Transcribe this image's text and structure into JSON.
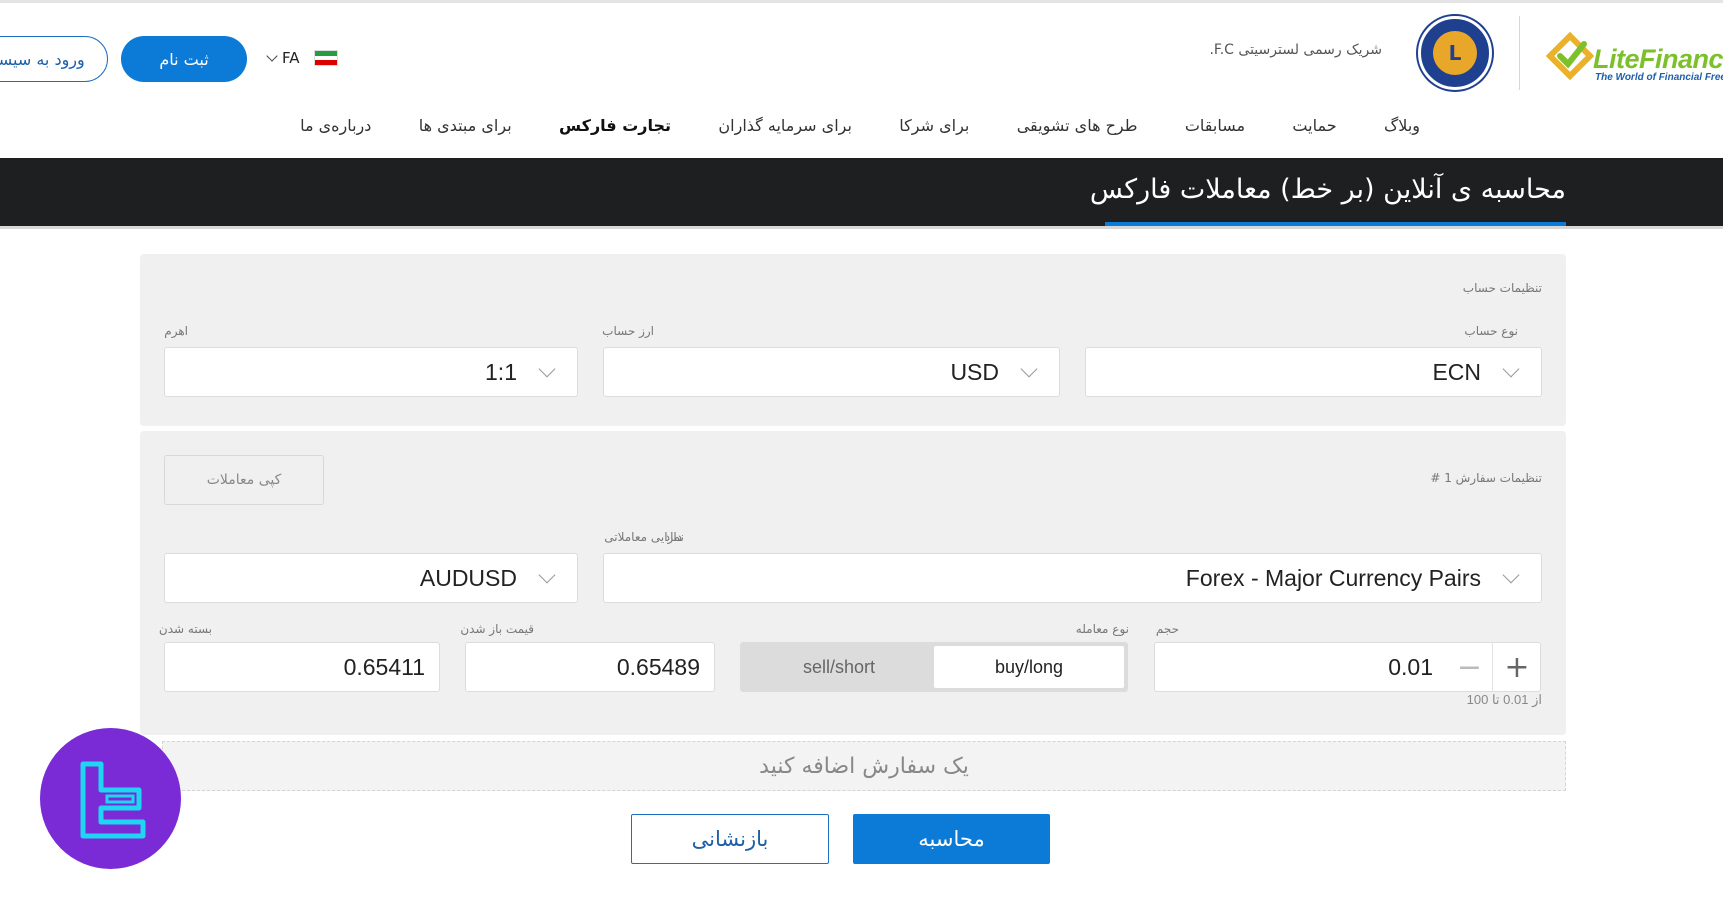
{
  "header": {
    "login_label": "ورود به سیستم",
    "signup_label": "ثبت نام",
    "language": "FA",
    "partner_text": "شریک رسمی لسترسیتی F.C.",
    "crest_letter": "L",
    "brand_name": "LiteFinance",
    "brand_tagline": "The World of Financial Freedom",
    "accent_color": "#0c7ad7",
    "brand_green": "#7cc12b"
  },
  "nav": {
    "items": [
      {
        "label": "درباره‌ی ما"
      },
      {
        "label": "برای مبتدی ها"
      },
      {
        "label": "تجارت فارکس"
      },
      {
        "label": "برای سرمایه گذاران"
      },
      {
        "label": "برای شرکا"
      },
      {
        "label": "طرح های تشویقی"
      },
      {
        "label": "مسابقات"
      },
      {
        "label": "حمایت"
      },
      {
        "label": "وبلاگ"
      }
    ],
    "active": "تجارت فارکس"
  },
  "page": {
    "title": "محاسبه ی آنلاین (بر خط) معاملات فارکس"
  },
  "account_settings": {
    "section_title": "تنظیمات حساب",
    "account_type_label": "نوع حساب",
    "account_type_value": "ECN",
    "currency_label": "ارز حساب",
    "currency_value": "USD",
    "leverage_label": "اهرم",
    "leverage_value": "1:1"
  },
  "order_settings": {
    "section_title": "تنظیمات سفارش 1 #",
    "copy_trades_label": "کپی معاملات",
    "asset_label": "دارایی معاملاتی",
    "asset_value": "Forex - Major Currency Pairs",
    "symbol_label": "نماد",
    "symbol_value": "AUDUSD",
    "volume_label": "حجم",
    "volume_value": "0.01",
    "volume_plus": "+",
    "volume_minus": "−",
    "volume_range": "از 0.01 تا 100",
    "trade_type_label": "نوع معامله",
    "buy_label": "buy/long",
    "sell_label": "sell/short",
    "selected_trade_type": "buy/long",
    "open_price_label": "قیمت باز شدن",
    "open_price_value": "0.65489",
    "close_price_label": "بسته شدن",
    "close_price_value": "0.65411"
  },
  "actions": {
    "add_order_label": "یک سفارش اضافه کنید",
    "calculate_label": "محاسبه",
    "reset_label": "بازنشانی"
  }
}
